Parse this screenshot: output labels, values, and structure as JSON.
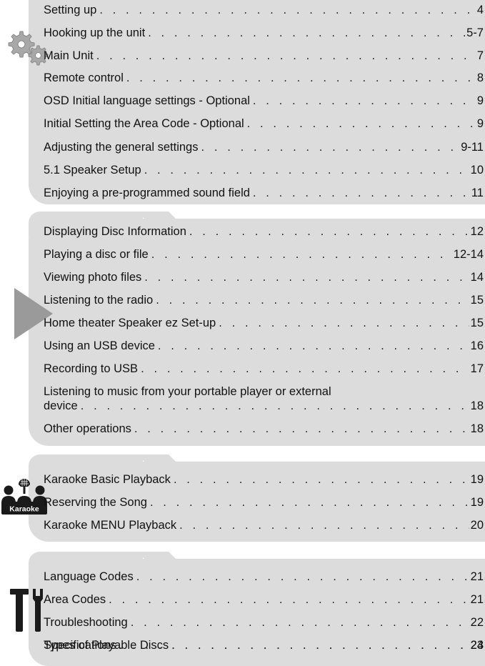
{
  "sections": [
    {
      "icon": "gears-icon",
      "entries": [
        {
          "label": "Setting up",
          "page": "4"
        },
        {
          "label": "Hooking up the unit",
          "page": "5-7"
        },
        {
          "label": "Main Unit",
          "page": "7"
        },
        {
          "label": "Remote control",
          "page": "8"
        },
        {
          "label": "OSD Initial language settings - Optional",
          "page": "9"
        },
        {
          "label": "Initial Setting the Area Code - Optional",
          "page": "9"
        },
        {
          "label": "Adjusting the general settings",
          "page": "9-11"
        },
        {
          "label": "5.1 Speaker Setup",
          "page": "10"
        },
        {
          "label": "Enjoying a pre-programmed sound field",
          "page": "11"
        }
      ]
    },
    {
      "icon": "play-icon",
      "entries": [
        {
          "label": "Displaying Disc Information",
          "page": "12"
        },
        {
          "label": "Playing a disc or file",
          "page": "12-14"
        },
        {
          "label": "Viewing photo files",
          "page": "14"
        },
        {
          "label": "Listening to the radio",
          "page": "15"
        },
        {
          "label": "Home theater Speaker ez Set-up",
          "page": "15"
        },
        {
          "label": "Using an USB device",
          "page": "16"
        },
        {
          "label": "Recording to USB",
          "page": "17"
        },
        {
          "label_line1": "Listening to music from your portable player or external",
          "label": "device",
          "page": "18"
        },
        {
          "label": "Other operations",
          "page": "18"
        }
      ]
    },
    {
      "icon": "karaoke-icon",
      "icon_text": "Karaoke",
      "entries": [
        {
          "label": "Karaoke Basic Playback",
          "page": "19"
        },
        {
          "label": "Reserving the Song",
          "page": "19"
        },
        {
          "label": "Karaoke MENU Playback",
          "page": "20"
        }
      ]
    },
    {
      "icon": "tools-icon",
      "entries": [
        {
          "label": "Language Codes",
          "page": "21"
        },
        {
          "label": "Area Codes",
          "page": "21"
        },
        {
          "label": "Troubleshooting",
          "page": "22"
        },
        {
          "label": "Types of Playable Discs",
          "page": "23"
        },
        {
          "label": "Specifications",
          "page": "24"
        }
      ]
    }
  ],
  "colors": {
    "panel": "#dcdcdc",
    "icon_gray": "#9a9a9a",
    "icon_dark": "#1a1a1a"
  }
}
